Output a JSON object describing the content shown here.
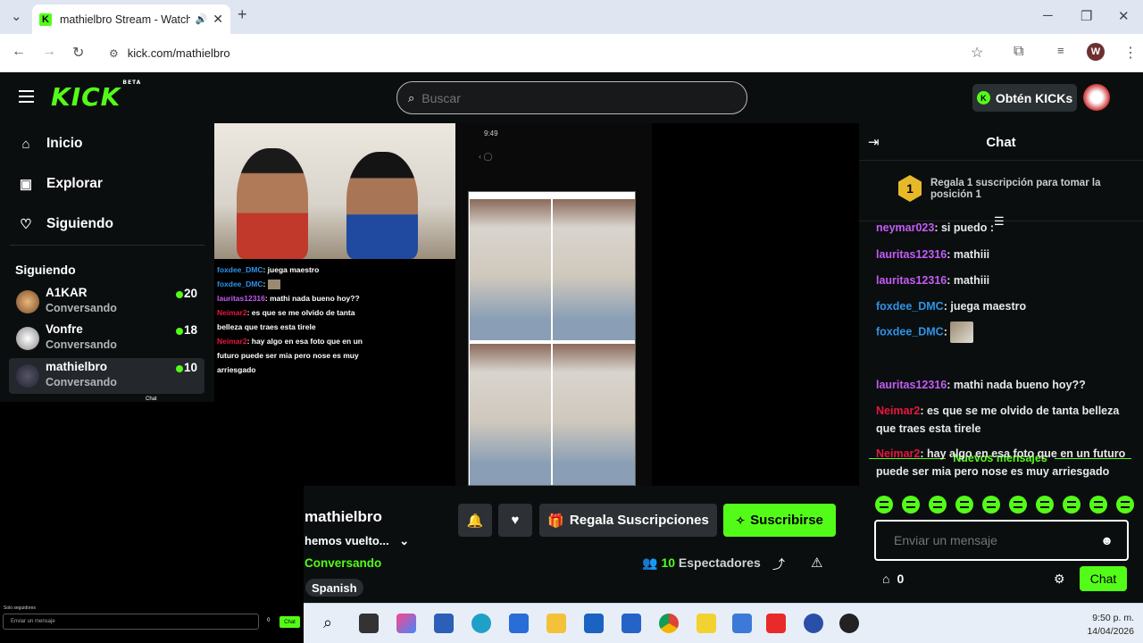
{
  "browser": {
    "tab_title": "mathielbro Stream - Watch",
    "url": "kick.com/mathielbro",
    "profile_letter": "W"
  },
  "header": {
    "logo": "KICK",
    "logo_badge": "BETA",
    "search_placeholder": "Buscar",
    "kicks_label": "Obtén KICKs"
  },
  "sidebar": {
    "nav": [
      {
        "label": "Inicio",
        "icon": "home-icon"
      },
      {
        "label": "Explorar",
        "icon": "compass-icon"
      },
      {
        "label": "Siguiendo",
        "icon": "heart-icon"
      }
    ],
    "following_heading": "Siguiendo",
    "channels": [
      {
        "name": "A1KAR",
        "status": "Conversando",
        "viewers": "20"
      },
      {
        "name": "Vonfre",
        "status": "Conversando",
        "viewers": "18"
      },
      {
        "name": "mathielbro",
        "status": "Conversando",
        "viewers": "10"
      }
    ]
  },
  "video": {
    "overlay_chat": [
      {
        "user": "foxdee_DMC",
        "text": ": juega maestro",
        "color": "#2e93e8"
      },
      {
        "user": "foxdee_DMC",
        "text": ": ",
        "color": "#2e93e8"
      },
      {
        "user": "lauritas12316",
        "text": ": mathi nada bueno hoy??",
        "color": "#c45cf5"
      },
      {
        "user": "Neimar2",
        "text": ": es que se me olvido de tanta belleza que traes esta tirele",
        "color": "#e8163e"
      },
      {
        "user": "Neimar2",
        "text": ": hay algo en esa foto que en un futuro puede ser mia pero nose es muy arriesgado",
        "color": "#e8163e"
      }
    ],
    "phone_time": "9:49",
    "mini_label": "Chat",
    "mini_hint": "Solo seguidores",
    "mini_placeholder": "Enviar un mensaje",
    "mini_count": "0",
    "mini_chat_btn": "Chat"
  },
  "stream": {
    "name": "mathielbro",
    "title": "hemos vuelto...",
    "category": "Conversando",
    "language": "Spanish",
    "gift_label": "Regala Suscripciones",
    "subscribe_label": "Suscribirse",
    "viewers_count": "10",
    "viewers_label": "Espectadores"
  },
  "chat": {
    "title": "Chat",
    "pinned": "Regala 1 suscripción para tomar la posición 1",
    "pinned_rank": "1",
    "messages": [
      {
        "user": "neymar023",
        "text": ": si puedo :"
      },
      {
        "user": "lauritas12316",
        "text": ": mathiii"
      },
      {
        "user": "lauritas12316",
        "text": ": mathiii"
      },
      {
        "user": "foxdee_DMC",
        "text": ": juega maestro"
      },
      {
        "user": "foxdee_DMC",
        "text": ": "
      },
      {
        "user": "lauritas12316",
        "text": ": mathi nada bueno hoy??"
      },
      {
        "user": "Neimar2",
        "text": ": es que se me olvido de tanta belleza que traes esta tirele"
      },
      {
        "user": "Neimar2",
        "text": ": hay algo en esa foto que en un futuro puede ser mia pero nose es muy arriesgado"
      }
    ],
    "new_messages": "Nuevos mensajes",
    "input_placeholder": "Enviar un mensaje",
    "kicks_count": "0",
    "send_label": "Chat"
  },
  "taskbar": {
    "time": "9:50 p. m.",
    "date": "14/04/2026"
  }
}
